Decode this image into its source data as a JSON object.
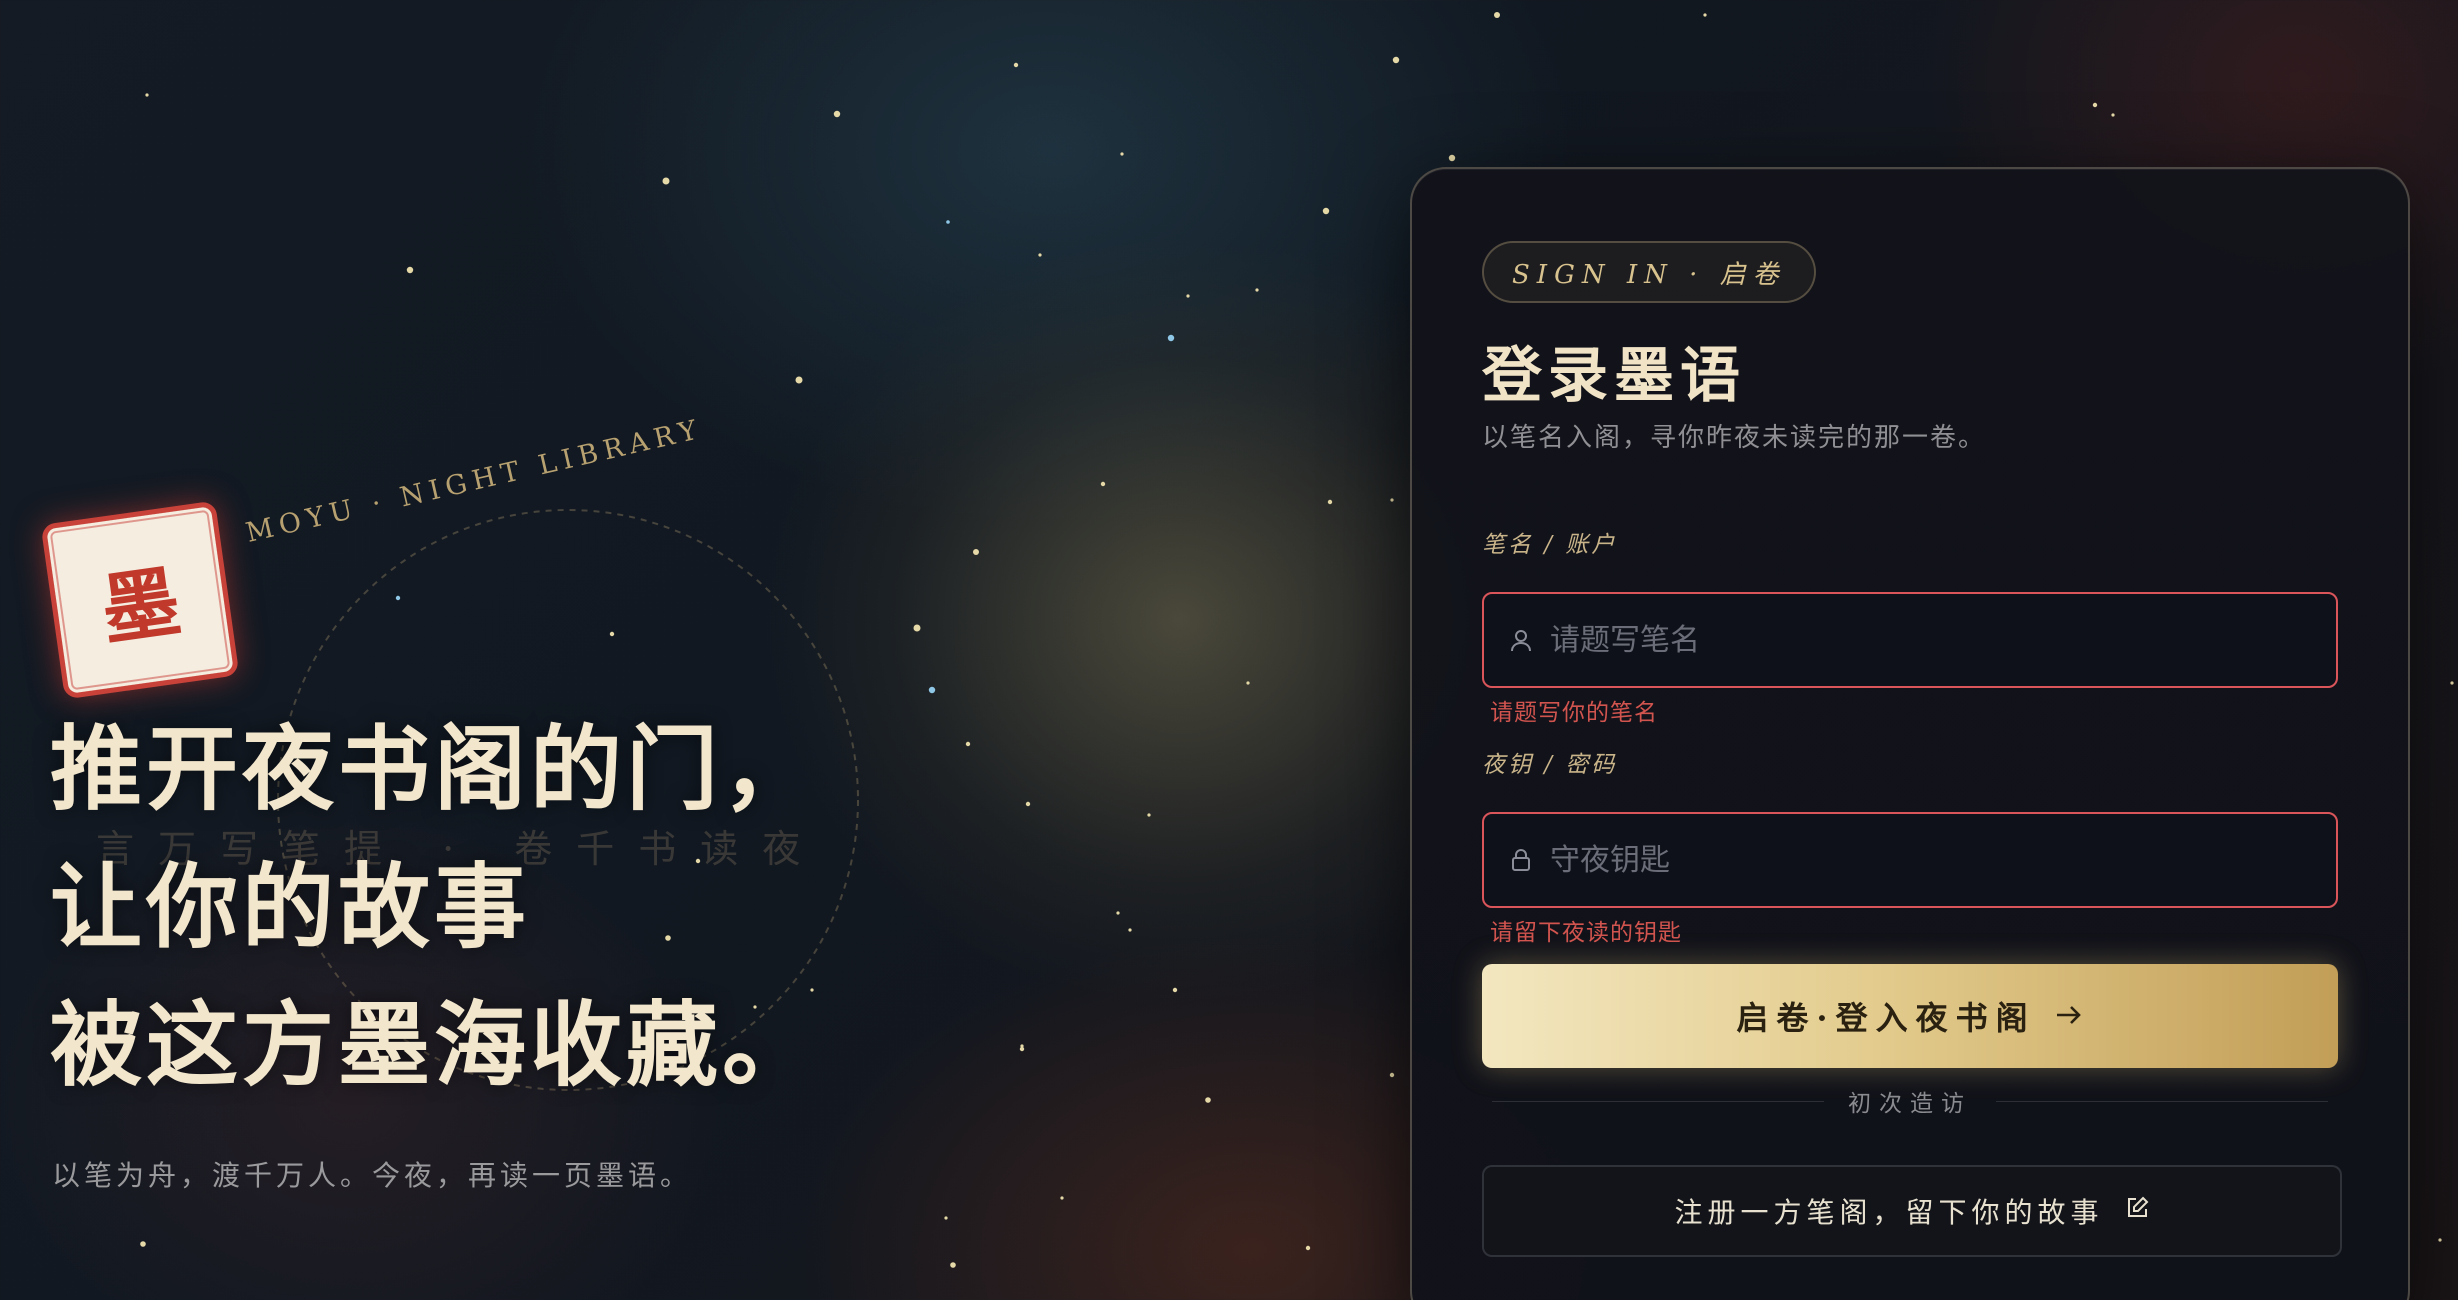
{
  "brand": {
    "seal_char": "墨",
    "tagline_en": "MOYU · NIGHT LIBRARY",
    "ghost_text": "言万写笔提 · 卷千书读夜"
  },
  "hero": {
    "headline_lines": [
      "推开夜书阁的门，",
      "让你的故事",
      "被这方墨海收藏。"
    ],
    "subtext": "以笔为舟，渡千万人。今夜，再读一页墨语。"
  },
  "login": {
    "badge": "SIGN IN · 启卷",
    "title": "登录墨语",
    "subtitle": "以笔名入阁，寻你昨夜未读完的那一卷。",
    "username": {
      "label": "笔名 / 账户",
      "placeholder": "请题写笔名",
      "value": "",
      "error": "请题写你的笔名",
      "icon": "user-icon"
    },
    "password": {
      "label": "夜钥 / 密码",
      "placeholder": "守夜钥匙",
      "value": "",
      "error": "请留下夜读的钥匙",
      "icon": "lock-icon"
    },
    "submit_label": "启卷·登入夜书阁",
    "divider_text": "初次造访",
    "register_label": "注册一方笔阁，留下你的故事"
  },
  "colors": {
    "accent_gold": "#e3cc8e",
    "error_red": "#d9555a",
    "seal_red": "#c0392b",
    "headline": "#f2e6cc"
  }
}
